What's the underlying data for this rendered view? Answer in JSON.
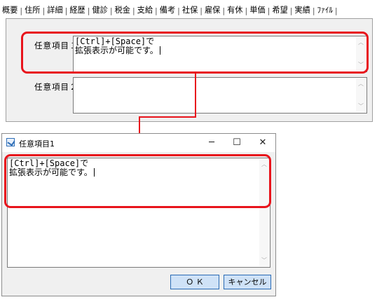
{
  "tabs": [
    {
      "label": "概要"
    },
    {
      "label": "住所"
    },
    {
      "label": "詳細"
    },
    {
      "label": "経歴"
    },
    {
      "label": "健診"
    },
    {
      "label": "税金"
    },
    {
      "label": "支給"
    },
    {
      "label": "備考"
    },
    {
      "label": "社保"
    },
    {
      "label": "雇保"
    },
    {
      "label": "有休"
    },
    {
      "label": "単価"
    },
    {
      "label": "希望"
    },
    {
      "label": "実績"
    },
    {
      "label": "ﾌｧｲﾙ"
    }
  ],
  "active_tab": "備考",
  "form": {
    "field1_label": "任意項目１",
    "field1_line1": "[Ctrl]+[Space]で",
    "field1_line2": "拡張表示が可能です。",
    "field2_label": "任意項目２",
    "field2_value": ""
  },
  "dialog": {
    "title": "任意項目1",
    "minimize": "─",
    "maximize": "☐",
    "close": "✕",
    "text_line1": "[Ctrl]+[Space]で",
    "text_line2": "拡張表示が可能です。",
    "ok_label": "Ｏ Ｋ",
    "cancel_label": "キャンセル"
  },
  "colors": {
    "highlight": "#e8141c",
    "button": "#cfe2f7",
    "button_border": "#2a6bb5"
  },
  "icons": {
    "dialog": "app-window-icon",
    "scroll_up": "chevron-up-icon",
    "scroll_down": "chevron-down-icon"
  }
}
